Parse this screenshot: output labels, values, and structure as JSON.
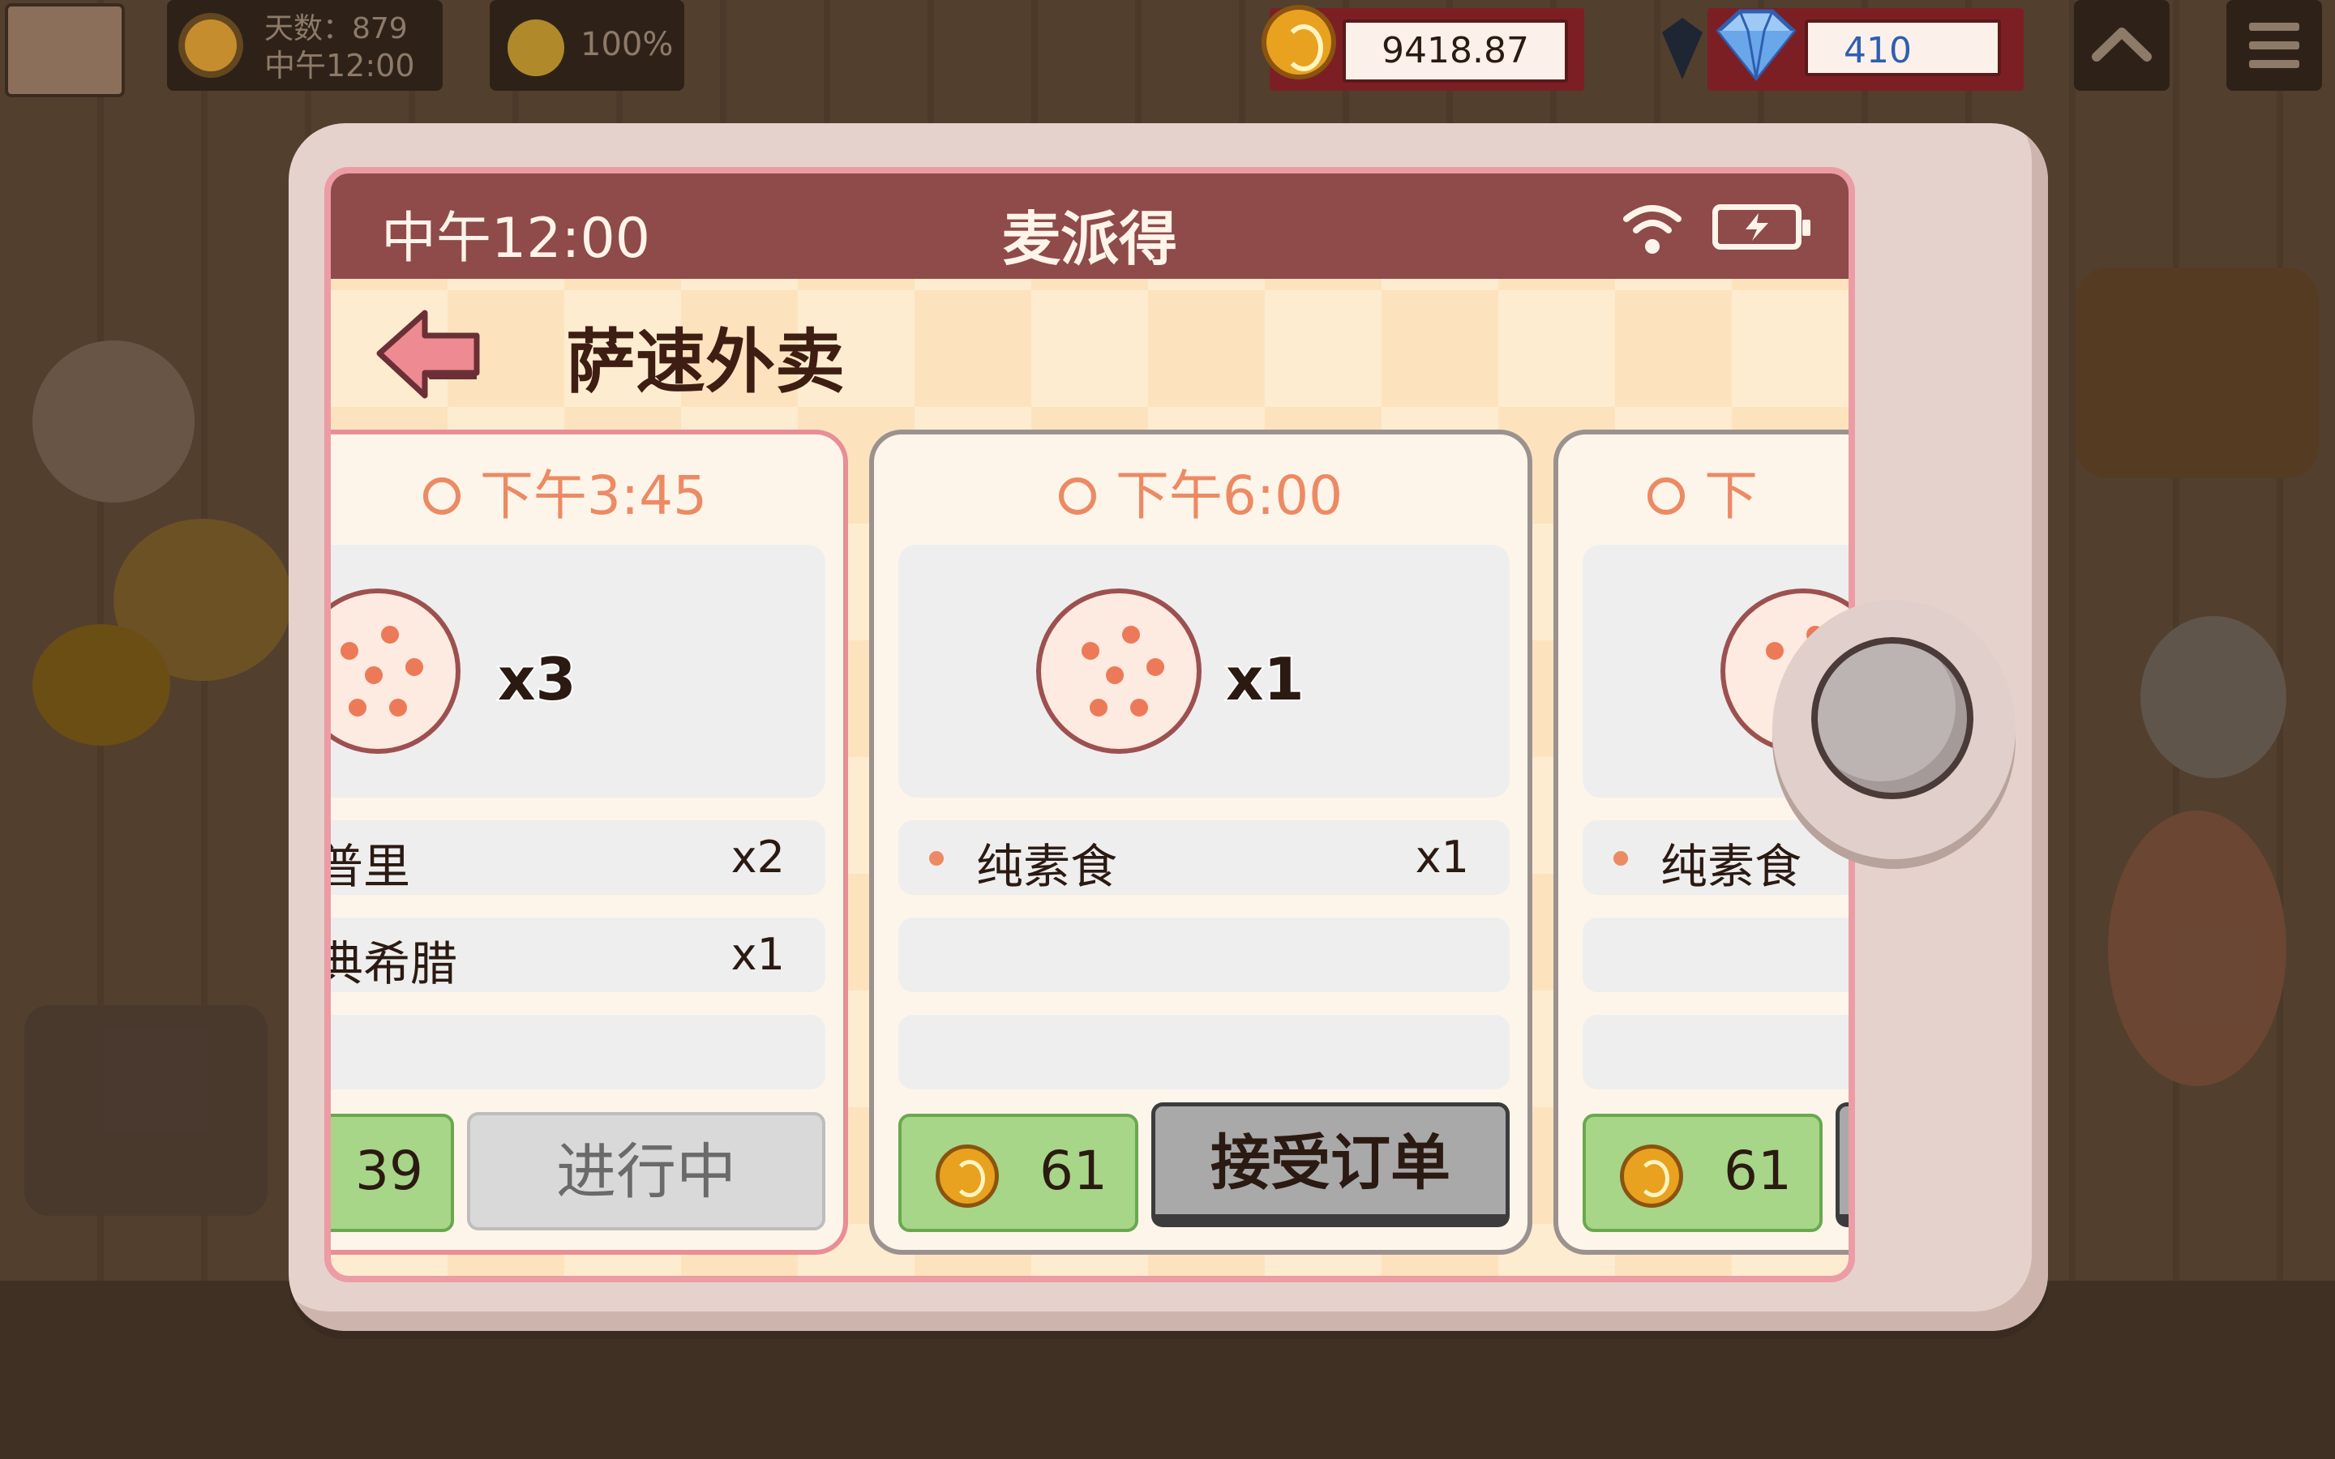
{
  "hud": {
    "day_label": "天数：879",
    "time_label": "中午12:00",
    "mood_percent": "100%",
    "coins": "9418.87",
    "gems": "410"
  },
  "phone": {
    "status_time": "中午12:00",
    "app_name": "麦派得",
    "page_title": "萨速外卖"
  },
  "orders": [
    {
      "due": "下午3:45",
      "quantity": "x3",
      "items": [
        {
          "name": "普里",
          "count": "x2"
        },
        {
          "name": "典希腊",
          "count": "x1"
        }
      ],
      "reward": "39",
      "action": "进行中"
    },
    {
      "due": "下午6:00",
      "quantity": "x1",
      "items": [
        {
          "name": "纯素食",
          "count": "x1"
        }
      ],
      "reward": "61",
      "action": "接受订单"
    },
    {
      "due": "下",
      "items": [
        {
          "name": "纯素食"
        }
      ],
      "reward": "61"
    }
  ],
  "colors": {
    "status_bar": "#8f4a4a",
    "card_active_border": "#e88e97",
    "reward_green": "#a7d688",
    "due_orange": "#ec8a64"
  },
  "icons": [
    "sun-icon",
    "smile-icon",
    "coin-icon",
    "diamond-icon",
    "chevron-up-icon",
    "menu-icon",
    "wifi-icon",
    "battery-icon",
    "back-arrow-icon",
    "clock-icon",
    "pizza-icon"
  ]
}
